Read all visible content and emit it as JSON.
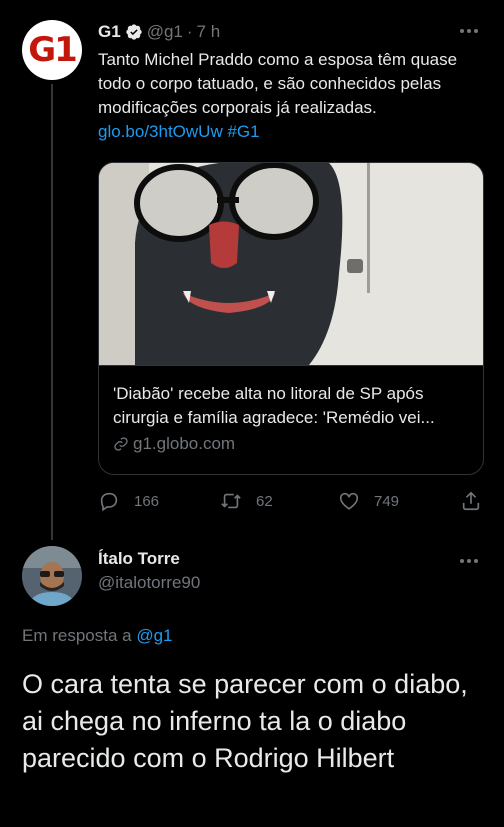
{
  "tweet": {
    "author_name": "G1",
    "author_handle": "@g1",
    "separator": "·",
    "time": "7 h",
    "avatar_text": "G1",
    "text_main": "Tanto Michel Praddo como a esposa têm quase todo o corpo tatuado, e são conhecidos pelas modificações corporais já realizadas.",
    "link_url": "glo.bo/3htOwUw",
    "hashtag": "#G1",
    "card": {
      "title": "'Diabão' recebe alta no litoral de SP após cirurgia e família agradece: 'Remédio vei...",
      "domain": "g1.globo.com"
    },
    "stats": {
      "replies": "166",
      "retweets": "62",
      "likes": "749"
    }
  },
  "reply": {
    "author_name": "Ítalo Torre",
    "author_handle": "@italotorre90",
    "reply_prefix": "Em resposta a",
    "reply_handle": "@g1",
    "text": "O cara tenta se parecer com o diabo, ai chega no inferno ta la o diabo parecido com o Rodrigo Hilbert"
  },
  "icons": {
    "verified": "verified-badge-icon",
    "more": "more-options-icon",
    "reply": "reply-icon",
    "retweet": "retweet-icon",
    "like": "heart-icon",
    "share": "share-icon",
    "link": "link-icon"
  },
  "colors": {
    "background": "#000000",
    "text": "#e7e9ea",
    "muted": "#71767b",
    "accent": "#1d9bf0",
    "g1_red": "#c4170c"
  }
}
